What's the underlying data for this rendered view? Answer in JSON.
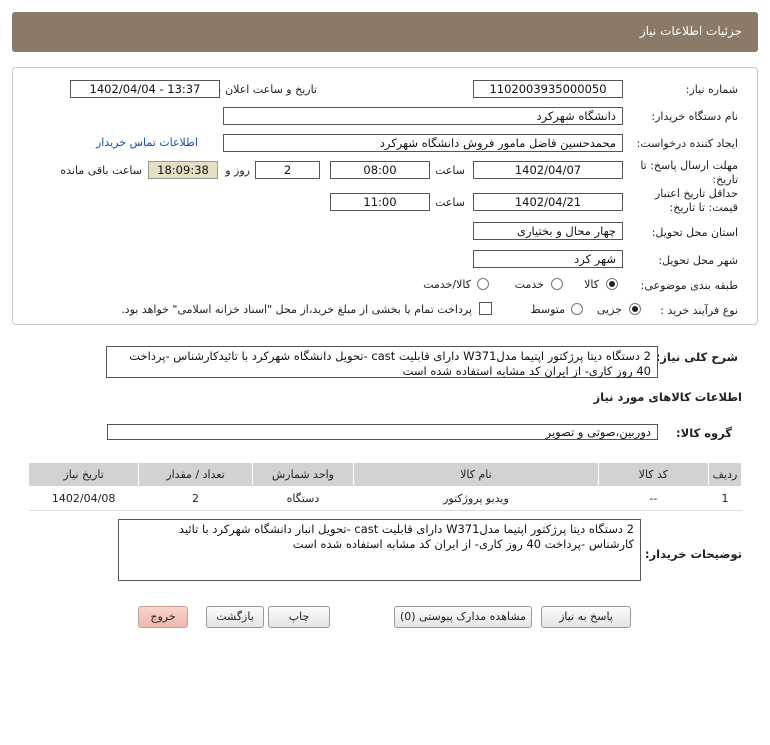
{
  "header": {
    "title": "جزئیات اطلاعات نیاز"
  },
  "form": {
    "need_number_label": "شماره نیاز:",
    "need_number": "1102003935000050",
    "announce_label": "تاریخ و ساعت اعلان عمومی:",
    "announce_value": "1402/04/04 - 13:37",
    "buyer_org_label": "نام دستگاه خریدار:",
    "buyer_org": "دانشگاه شهرکرد",
    "requester_label": "ایجاد کننده درخواست:",
    "requester": "محمدحسین فاضل مامور فروش دانشگاه شهرکرد",
    "contact_link": "اطلاعات تماس خریدار",
    "deadline_label": "مهلت ارسال پاسخ: تا تاریخ:",
    "deadline_date": "1402/04/07",
    "deadline_time_label": "ساعت",
    "deadline_time": "08:00",
    "days_remaining": "2",
    "days_label": "روز و",
    "time_remaining": "18:09:38",
    "remaining_label": "ساعت باقی مانده",
    "validity_label": "حداقل تاریخ اعتبار قیمت: تا تاریخ:",
    "validity_date": "1402/04/21",
    "validity_time_label": "ساعت",
    "validity_time": "11:00",
    "province_label": "استان محل تحویل:",
    "province": "چهار محال و بختیاری",
    "city_label": "شهر محل تحویل:",
    "city": "شهر کرد",
    "category_label": "طبقه بندی موضوعی:",
    "category_options": [
      "کالا",
      "خدمت",
      "کالا/خدمت"
    ],
    "purchase_type_label": "نوع فرآیند خرید :",
    "purchase_options": [
      "جزیی",
      "متوسط"
    ],
    "treasury_note": "پرداخت تمام یا بخشی از مبلغ خرید،از محل \"اسناد خزانه اسلامی\" خواهد بود."
  },
  "summary": {
    "label": "شرح کلی نیاز:",
    "text": "2 دستگاه دیتا پرژکتور اپتیما مدلW371 دارای قابلیت cast -تحویل دانشگاه شهرکرد با تائیدکارشناس -پرداخت 40 روز کاری- از ایران کد مشابه استفاده شده است"
  },
  "goods": {
    "section_title": "اطلاعات کالاهای مورد نیاز",
    "group_label": "گروه کالا:",
    "group_value": "دوربین،صوتی و تصویر",
    "columns": [
      "ردیف",
      "کد کالا",
      "نام کالا",
      "واحد شمارش",
      "تعداد / مقدار",
      "تاریخ نیاز"
    ],
    "rows": [
      [
        "1",
        "--",
        "ویدیو پروژکتور",
        "دستگاه",
        "2",
        "1402/04/08"
      ]
    ]
  },
  "buyer_notes": {
    "label": "توضیحات خریدار:",
    "text": "2 دستگاه دیتا پرژکتور اپتیما مدلW371 دارای قابلیت cast -تحویل انبار دانشگاه شهرکرد با تائید\nکارشناس -پرداخت 40 روز کاری- از ایران کد مشابه استفاده شده است"
  },
  "buttons": {
    "reply": "پاسخ به نیاز",
    "attachments": "مشاهده مدارک پیوستی (0)",
    "print": "چاپ",
    "back": "بازگشت",
    "exit": "خروج"
  },
  "colors": {
    "header": "#8a7a67",
    "highlight": "#e5dfc4",
    "exit_button": "#f0b8af",
    "link": "#1a4bb0"
  }
}
